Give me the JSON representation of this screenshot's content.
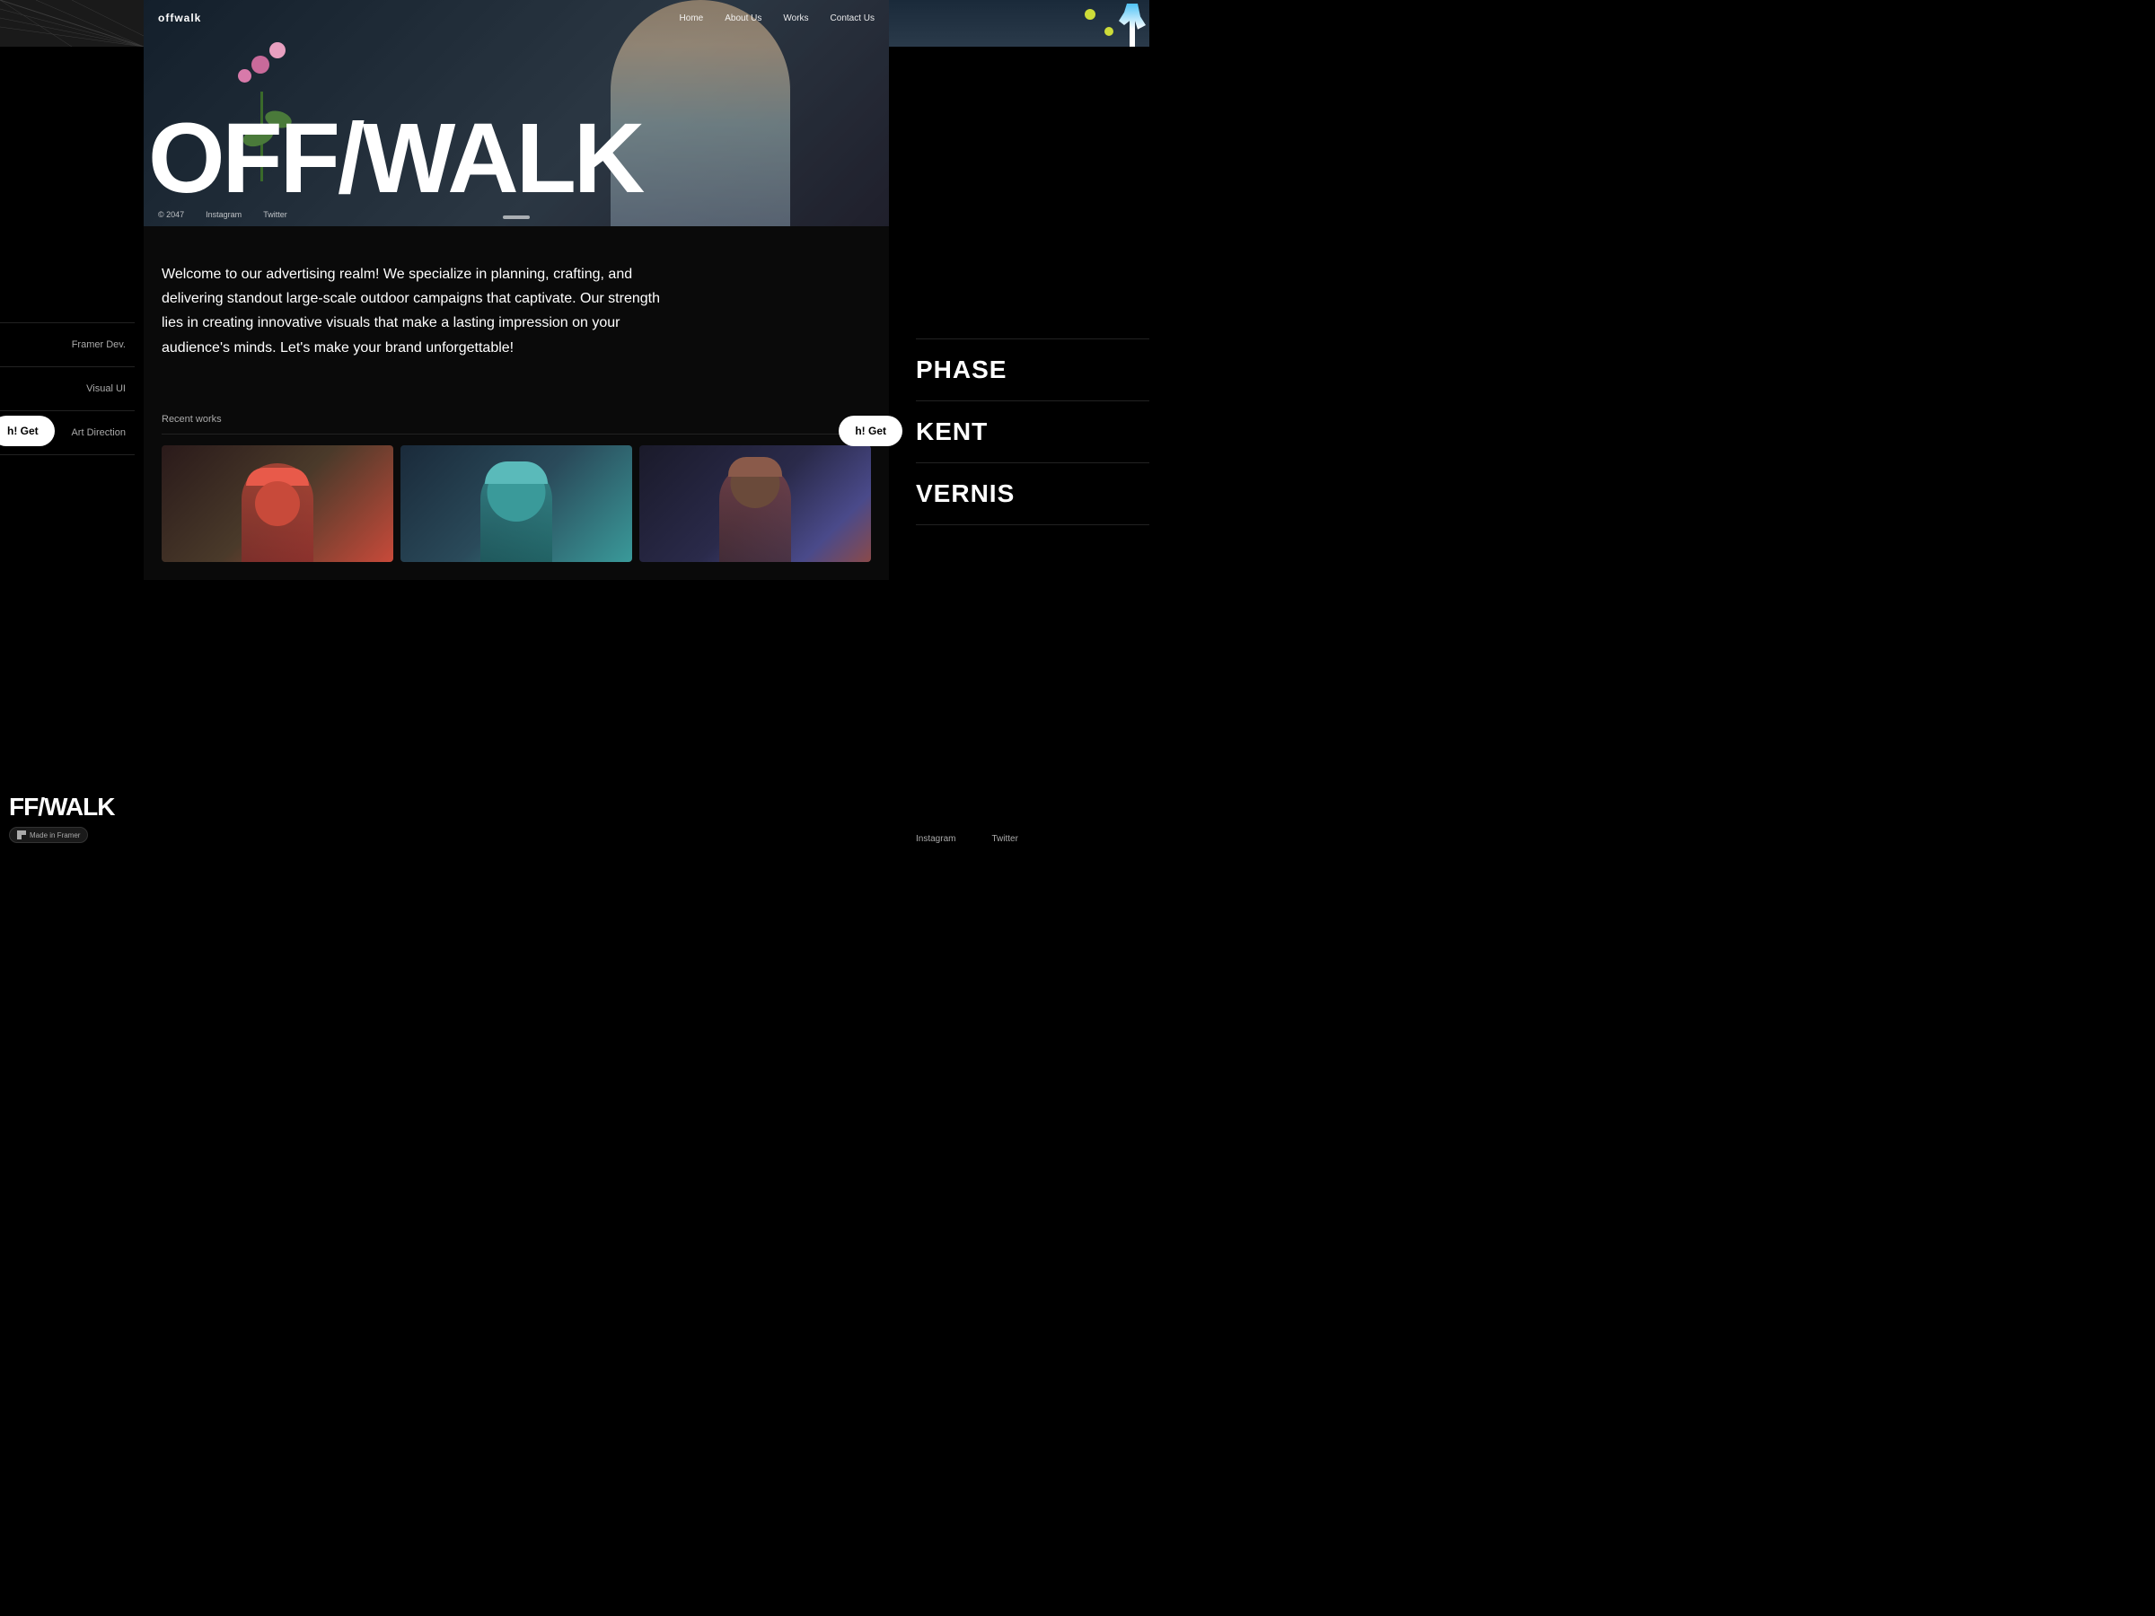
{
  "brand": {
    "logo": "offwalk",
    "logo_large": "FF/WALK"
  },
  "nav": {
    "home": "Home",
    "about": "About Us",
    "works": "Works",
    "contact": "Contact Us"
  },
  "hero": {
    "title": "OFF/WALK",
    "copyright": "© 2047",
    "instagram": "Instagram",
    "twitter": "Twitter"
  },
  "left_nav": {
    "items": [
      {
        "label": "Framer Dev."
      },
      {
        "label": "Visual UI"
      },
      {
        "label": "Art Direction"
      }
    ]
  },
  "right_works": {
    "items": [
      {
        "label": "PHASE"
      },
      {
        "label": "KENT"
      },
      {
        "label": "VERNIS"
      }
    ]
  },
  "right_footer": {
    "instagram": "Instagram",
    "twitter": "Twitter"
  },
  "welcome": {
    "text": "Welcome to our advertising realm! We specialize in planning, crafting, and delivering standout large-scale outdoor campaigns that captivate. Our strength lies in creating innovative visuals that make a lasting impression on your audience's minds. Let's make your brand unforgettable!"
  },
  "recent_works": {
    "title": "Recent works"
  },
  "marquee_btn": {
    "label": "h! Get"
  },
  "made_in_framer": "Made in Framer"
}
